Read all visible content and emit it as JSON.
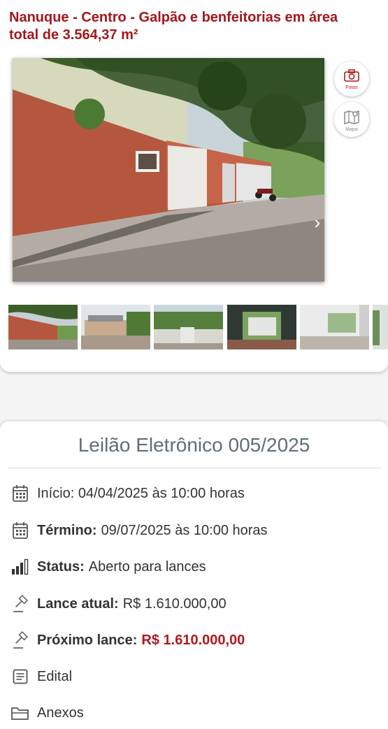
{
  "property": {
    "title": "Nanuque - Centro - Galpão e benfeitorias em área total de 3.564,37 m²"
  },
  "gallery": {
    "fotos_label": "Fotos",
    "mapa_label": "Mapa",
    "next_icon": "›",
    "thumbnail_count": 6
  },
  "auction": {
    "title": "Leilão Eletrônico 005/2025",
    "inicio": "Início: 04/04/2025 às 10:00 horas",
    "termino_label": "Término:",
    "termino_value": "09/07/2025 às 10:00 horas",
    "status_label": "Status:",
    "status_value": "Aberto para lances",
    "lance_atual_label": "Lance atual:",
    "lance_atual_value": "R$ 1.610.000,00",
    "proximo_lance_label": "Próximo lance:",
    "proximo_lance_value": "R$ 1.610.000,00",
    "edital": "Edital",
    "anexos": "Anexos"
  },
  "colors": {
    "brand_red": "#b2191e",
    "title_gray": "#5f6e76",
    "brick": "#b85a43"
  }
}
